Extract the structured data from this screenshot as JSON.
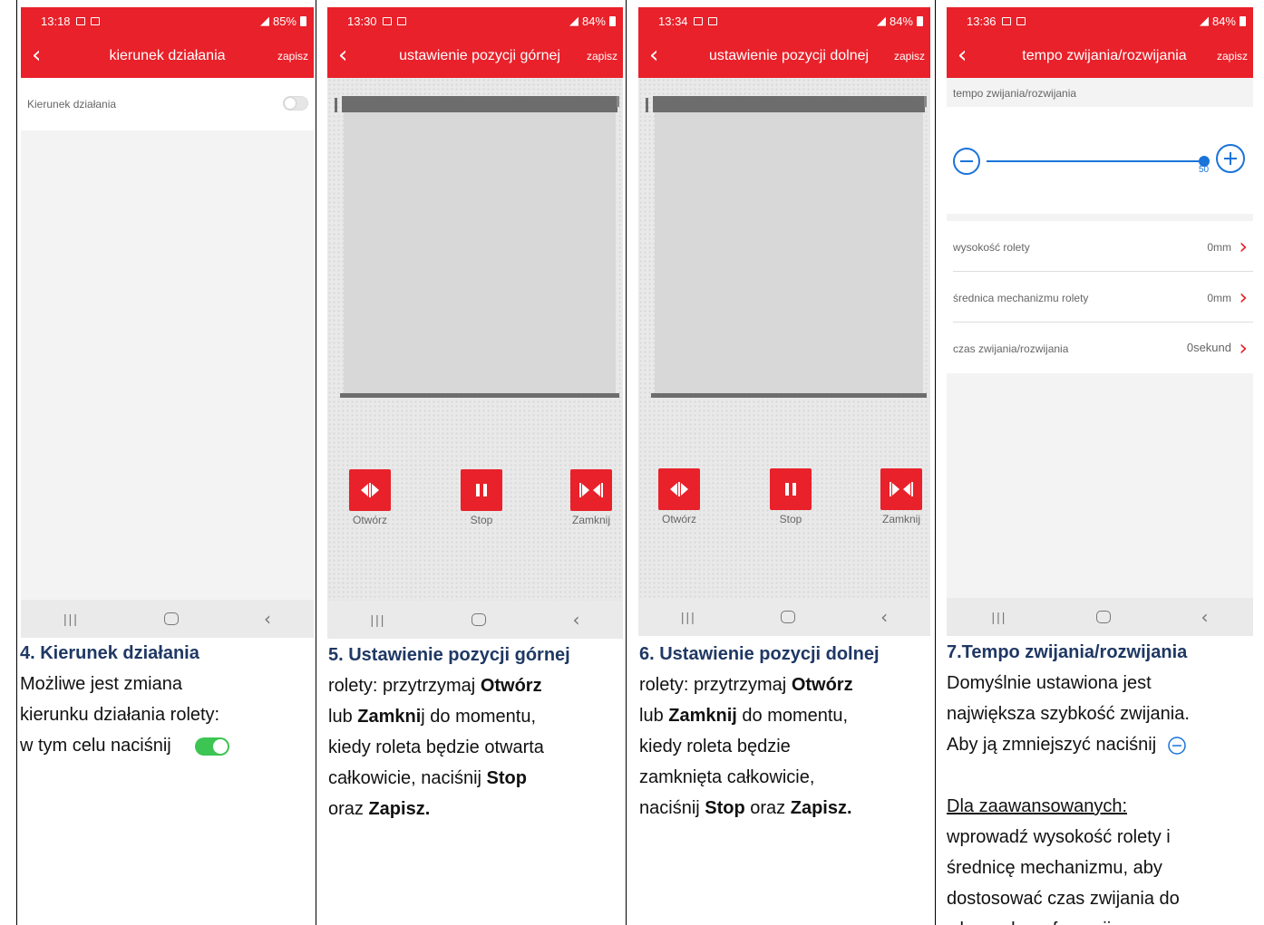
{
  "screen4": {
    "status_time": "13:18",
    "battery": "85%",
    "title": "kierunek działania",
    "save": "zapisz",
    "setting_label": "Kierunek działania",
    "caption_heading": "4. Kierunek działania",
    "caption_lines": [
      "Możliwe jest zmiana",
      "kierunku działania rolety:",
      "w tym celu naciśnij"
    ]
  },
  "screen5": {
    "status_time": "13:30",
    "battery": "84%",
    "title": "ustawienie pozycji górnej",
    "save": "zapisz",
    "open_label": "Otwórz",
    "stop_label": "Stop",
    "close_label": "Zamknij",
    "caption_heading": "5. Ustawienie pozycji górnej",
    "caption": {
      "t1": "rolety: przytrzymaj ",
      "b1": "Otwórz",
      "t2": "lub ",
      "b2": "Zamkni",
      "t3": "j do momentu,",
      "t4": "kiedy roleta będzie otwarta",
      "t5": "całkowicie, naciśnij ",
      "b3": "Stop",
      "t6": "oraz ",
      "b4": "Zapisz."
    }
  },
  "screen6": {
    "status_time": "13:34",
    "battery": "84%",
    "title": "ustawienie pozycji dolnej",
    "save": "zapisz",
    "open_label": "Otwórz",
    "stop_label": "Stop",
    "close_label": "Zamknij",
    "caption_heading": "6. Ustawienie pozycji dolnej",
    "caption": {
      "t1": "rolety: przytrzymaj ",
      "b1": "Otwórz",
      "t2": "lub ",
      "b2": "Zamknij",
      "t3": " do momentu,",
      "t4": "kiedy roleta będzie",
      "t5": "zamknięta całkowicie,",
      "t6": "naciśnij ",
      "b3": "Stop",
      "t7": " oraz ",
      "b4": "Zapisz."
    }
  },
  "screen7": {
    "status_time": "13:36",
    "battery": "84%",
    "title": "tempo zwijania/rozwijania",
    "save": "zapisz",
    "section_label": "tempo zwijania/rozwijania",
    "slider_value": "50",
    "slider_fraction": 1.0,
    "rows": [
      {
        "label": "wysokość rolety",
        "value": "0mm"
      },
      {
        "label": "średnica mechanizmu rolety",
        "value": "0mm"
      },
      {
        "label": "czas zwijania/rozwijania",
        "value": "0sekund"
      }
    ],
    "caption_heading": "7.Tempo zwijania/rozwijania",
    "caption_lines": [
      "Domyślnie ustawiona jest",
      "największa szybkość zwijania.",
      "Aby ją zmniejszyć  naciśnij"
    ],
    "advanced_label": "Dla zaawansowanych:",
    "advanced_lines": [
      "wprowadź wysokość rolety i",
      "średnicę mechanizmu, aby",
      "dostosować czas zwijania do",
      "własnych preferencji."
    ]
  },
  "colors": {
    "accent": "#e8212a",
    "heading": "#1f3864",
    "toggle_on": "#3cc552",
    "slider": "#1a73d9"
  }
}
